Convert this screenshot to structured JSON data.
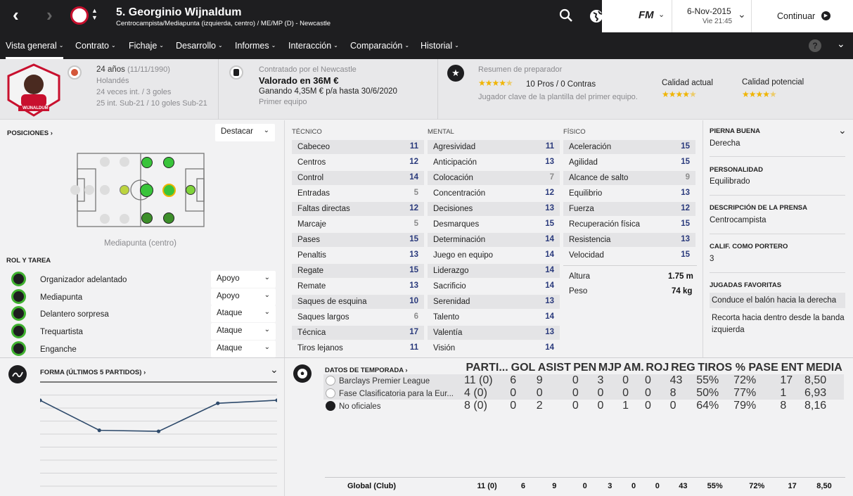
{
  "header": {
    "number_name": "5. Georginio Wijnaldum",
    "subtitle": "Centrocampista/Mediapunta (izquierda, centro) / ME/MP (D) - Newcastle",
    "date": "6-Nov-2015",
    "time": "Vie 21:45",
    "continue_label": "Continuar",
    "fm_logo": "FM"
  },
  "tabs": [
    {
      "label": "Vista general"
    },
    {
      "label": "Contrato"
    },
    {
      "label": "Fichaje"
    },
    {
      "label": "Desarrollo"
    },
    {
      "label": "Informes"
    },
    {
      "label": "Interacción"
    },
    {
      "label": "Comparación"
    },
    {
      "label": "Historial"
    }
  ],
  "bio": {
    "age": "24 años",
    "dob": "(11/11/1990)",
    "nationality": "Holandés",
    "caps": "24 veces int. / 3 goles",
    "u21": "25 int. Sub-21 / 10 goles Sub-21",
    "card_name": "WIJNALDUM"
  },
  "contract": {
    "by": "Contratado por el Newcastle",
    "value": "Valorado en 36M €",
    "wage": "Ganando 4,35M € p/a hasta 30/6/2020",
    "squad": "Primer equipo"
  },
  "coach": {
    "title": "Resumen de preparador",
    "pros": "10 Pros / 0 Contras",
    "note": "Jugador clave de la plantilla del primer equipo.",
    "current_label": "Calidad actual",
    "potential_label": "Calidad potencial",
    "stars_overall": 4.5,
    "stars_current": 4.5,
    "stars_potential": 4.5
  },
  "positions": {
    "title": "POSICIONES",
    "highlight_select": "Destacar",
    "caption": "Mediapunta (centro)"
  },
  "roles": {
    "title": "ROL Y TAREA",
    "items": [
      {
        "name": "Organizador adelantado",
        "duty": "Apoyo"
      },
      {
        "name": "Mediapunta",
        "duty": "Apoyo"
      },
      {
        "name": "Delantero sorpresa",
        "duty": "Ataque"
      },
      {
        "name": "Trequartista",
        "duty": "Ataque"
      },
      {
        "name": "Enganche",
        "duty": "Ataque"
      }
    ]
  },
  "attributes": {
    "technical_title": "TÉCNICO",
    "mental_title": "MENTAL",
    "physical_title": "FÍSICO",
    "technical": [
      {
        "name": "Cabeceo",
        "value": "11"
      },
      {
        "name": "Centros",
        "value": "12"
      },
      {
        "name": "Control",
        "value": "14"
      },
      {
        "name": "Entradas",
        "value": "5"
      },
      {
        "name": "Faltas directas",
        "value": "12"
      },
      {
        "name": "Marcaje",
        "value": "5"
      },
      {
        "name": "Pases",
        "value": "15"
      },
      {
        "name": "Penaltis",
        "value": "13"
      },
      {
        "name": "Regate",
        "value": "15"
      },
      {
        "name": "Remate",
        "value": "13"
      },
      {
        "name": "Saques de esquina",
        "value": "10"
      },
      {
        "name": "Saques largos",
        "value": "6"
      },
      {
        "name": "Técnica",
        "value": "17"
      },
      {
        "name": "Tiros lejanos",
        "value": "11"
      }
    ],
    "mental": [
      {
        "name": "Agresividad",
        "value": "11"
      },
      {
        "name": "Anticipación",
        "value": "13"
      },
      {
        "name": "Colocación",
        "value": "7"
      },
      {
        "name": "Concentración",
        "value": "12"
      },
      {
        "name": "Decisiones",
        "value": "13"
      },
      {
        "name": "Desmarques",
        "value": "15"
      },
      {
        "name": "Determinación",
        "value": "14"
      },
      {
        "name": "Juego en equipo",
        "value": "14"
      },
      {
        "name": "Liderazgo",
        "value": "14"
      },
      {
        "name": "Sacrificio",
        "value": "14"
      },
      {
        "name": "Serenidad",
        "value": "13"
      },
      {
        "name": "Talento",
        "value": "14"
      },
      {
        "name": "Valentía",
        "value": "13"
      },
      {
        "name": "Visión",
        "value": "14"
      }
    ],
    "physical": [
      {
        "name": "Aceleración",
        "value": "15"
      },
      {
        "name": "Agilidad",
        "value": "15"
      },
      {
        "name": "Alcance de salto",
        "value": "9"
      },
      {
        "name": "Equilibrio",
        "value": "13"
      },
      {
        "name": "Fuerza",
        "value": "12"
      },
      {
        "name": "Recuperación física",
        "value": "15"
      },
      {
        "name": "Resistencia",
        "value": "13"
      },
      {
        "name": "Velocidad",
        "value": "15"
      }
    ],
    "height_label": "Altura",
    "height": "1.75 m",
    "weight_label": "Peso",
    "weight": "74 kg"
  },
  "side": {
    "foot_title": "PIERNA BUENA",
    "foot": "Derecha",
    "personality_title": "PERSONALIDAD",
    "personality": "Equilibrado",
    "press_title": "DESCRIPCIÓN DE LA PRENSA",
    "press": "Centrocampista",
    "gk_title": "CALIF. COMO PORTERO",
    "gk": "3",
    "moves_title": "JUGADAS FAVORITAS",
    "moves": [
      "Conduce el balón hacia la derecha",
      "Recorta hacia dentro desde la banda izquierda"
    ]
  },
  "form": {
    "title": "FORMA (ÚLTIMOS 5 PARTIDOS)"
  },
  "chart_data": {
    "type": "line",
    "title": "FORMA (ÚLTIMOS 5 PARTIDOS)",
    "x": [
      1,
      2,
      3,
      4,
      5
    ],
    "values": [
      7.5,
      6.0,
      5.95,
      7.35,
      7.5
    ],
    "ylim": [
      3,
      8.2
    ],
    "grid": true
  },
  "season": {
    "title": "DATOS DE TEMPORADA",
    "columns": [
      "PARTI...",
      "GOL",
      "ASIST",
      "PEN",
      "MJP",
      "AM.",
      "ROJ",
      "REG",
      "TIROS",
      "% PASE",
      "ENT",
      "MEDIA"
    ],
    "rows": [
      {
        "comp": "Barclays Premier League",
        "cells": [
          "11 (0)",
          "6",
          "9",
          "0",
          "3",
          "0",
          "0",
          "43",
          "55%",
          "72%",
          "17",
          "8,50"
        ]
      },
      {
        "comp": "Fase Clasificatoria para la Eur...",
        "cells": [
          "4 (0)",
          "0",
          "0",
          "0",
          "0",
          "0",
          "0",
          "8",
          "50%",
          "77%",
          "1",
          "6,93"
        ]
      },
      {
        "comp": "No oficiales",
        "cells": [
          "8 (0)",
          "0",
          "2",
          "0",
          "0",
          "1",
          "0",
          "0",
          "64%",
          "79%",
          "8",
          "8,16"
        ]
      }
    ],
    "total_label": "Global (Club)",
    "total": [
      "11 (0)",
      "6",
      "9",
      "0",
      "3",
      "0",
      "0",
      "43",
      "55%",
      "72%",
      "17",
      "8,50"
    ]
  }
}
